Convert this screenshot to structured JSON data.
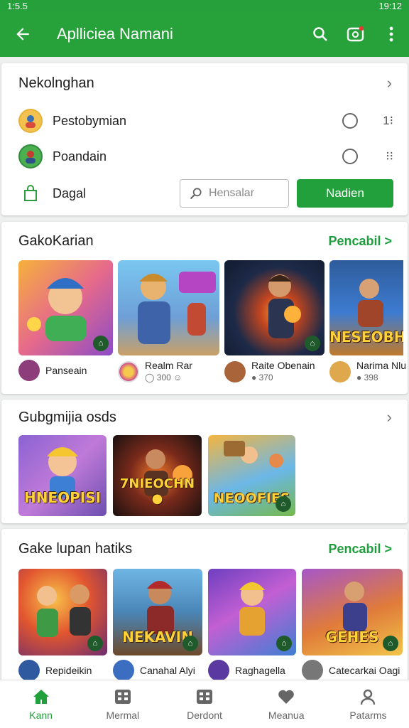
{
  "status_bar": {
    "time": "1:5.5",
    "right": "19:12"
  },
  "app_bar": {
    "title": "Aplliciea Namani",
    "back_icon": "arrow-back-icon",
    "search_icon": "search-icon",
    "camera_icon": "camera-badge-icon",
    "more_icon": "more-vert-icon"
  },
  "colors": {
    "brand": "#27a13a",
    "accent": "#1e9d3c"
  },
  "section1": {
    "title": "Nekolnghan",
    "rows": [
      {
        "label": "Pestobymian",
        "meta": "1⁝"
      },
      {
        "label": "Poandain",
        "meta": "⁝⁝"
      }
    ],
    "daga_label": "Dagal",
    "search_placeholder": "Hensalar",
    "button_label": "Nadien"
  },
  "section2": {
    "title": "GakoKarian",
    "see_all": "Pencabil >",
    "games": [
      {
        "name": "Panseain",
        "sub": ""
      },
      {
        "name": "Realm Rar",
        "sub": "◯ 300 ☺"
      },
      {
        "name": "Raite Obenain",
        "sub": "● 370"
      },
      {
        "name": "Narima Nlu",
        "sub": "● 398"
      }
    ],
    "captions": [
      "",
      "",
      "",
      "NESEOBH"
    ]
  },
  "section3": {
    "title": "Gubgmijia osds",
    "captions": [
      "HNEOPISI",
      "7NIEOCHN ●",
      "NEOOFIES"
    ]
  },
  "section4": {
    "title": "Gake lupan hatiks",
    "see_all": "Pencabil >",
    "games": [
      {
        "name": "Repideikin"
      },
      {
        "name": "Canahal Alyi"
      },
      {
        "name": "Raghagella"
      },
      {
        "name": "Catecarkai Oagi"
      }
    ],
    "captions": [
      "",
      "NEKAVIN",
      "",
      "GEHES"
    ]
  },
  "bottom_nav": [
    {
      "label": "Kann",
      "icon": "home-icon"
    },
    {
      "label": "Mermal",
      "icon": "grid-icon"
    },
    {
      "label": "Derdont",
      "icon": "apps-icon"
    },
    {
      "label": "Meanua",
      "icon": "heart-icon"
    },
    {
      "label": "Patarms",
      "icon": "person-icon"
    }
  ]
}
